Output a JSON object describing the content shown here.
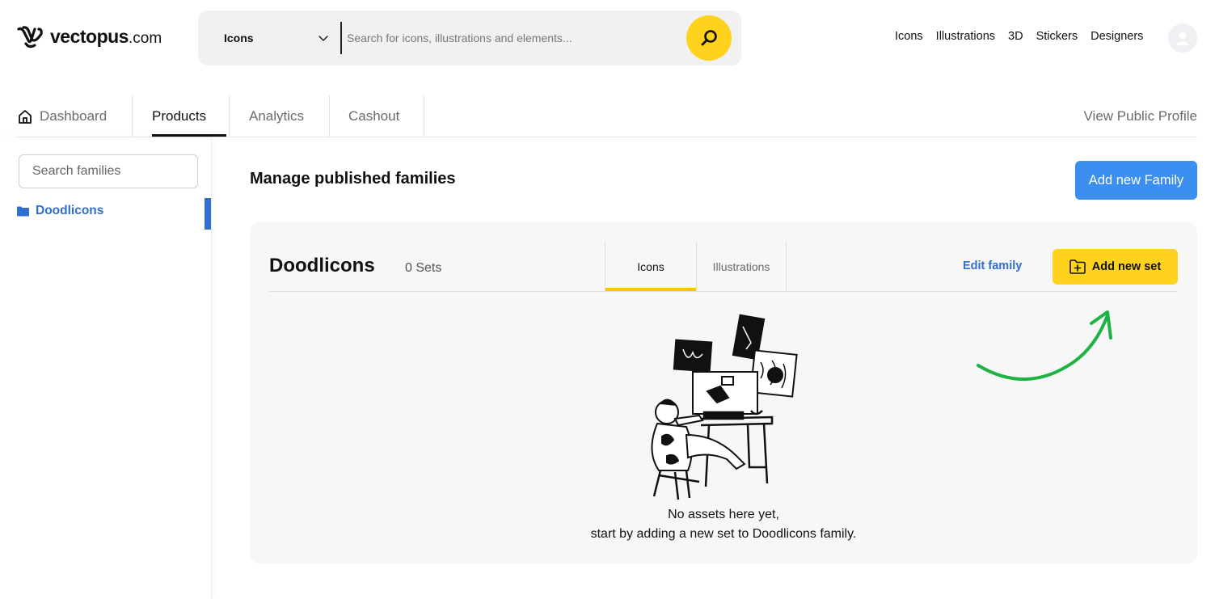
{
  "brand": {
    "name": "vectopus",
    "suffix": ".com"
  },
  "search": {
    "type_value": "Icons",
    "placeholder": "Search for icons, illustrations and elements..."
  },
  "top_nav": [
    {
      "label": "Icons"
    },
    {
      "label": "Illustrations"
    },
    {
      "label": "3D"
    },
    {
      "label": "Stickers"
    },
    {
      "label": "Designers"
    }
  ],
  "tabs": [
    {
      "label": "Dashboard"
    },
    {
      "label": "Products"
    },
    {
      "label": "Analytics"
    },
    {
      "label": "Cashout"
    }
  ],
  "active_tab": "Products",
  "view_public_profile": "View Public Profile",
  "sidebar": {
    "search_placeholder": "Search families",
    "families": [
      {
        "label": "Doodlicons"
      }
    ]
  },
  "main": {
    "title": "Manage published families",
    "add_family_label": "Add new Family",
    "card": {
      "family_name": "Doodlicons",
      "sets_count": "0 Sets",
      "subtabs": [
        {
          "label": "Icons"
        },
        {
          "label": "Illustrations"
        }
      ],
      "active_subtab": "Icons",
      "edit_family_label": "Edit family",
      "add_set_label": "Add new set",
      "empty_line1": "No assets here yet,",
      "empty_line2": "start by adding a new set to Doodlicons family."
    }
  },
  "colors": {
    "accent_yellow": "#ffd21e",
    "accent_blue": "#2f6fd1",
    "button_blue": "#3b8ff0",
    "annotation_green": "#1fb244"
  },
  "icons": [
    "vectopus-logo-icon",
    "chevron-down-icon",
    "search-icon",
    "user-avatar-icon",
    "home-icon",
    "folder-icon",
    "folder-plus-icon"
  ]
}
